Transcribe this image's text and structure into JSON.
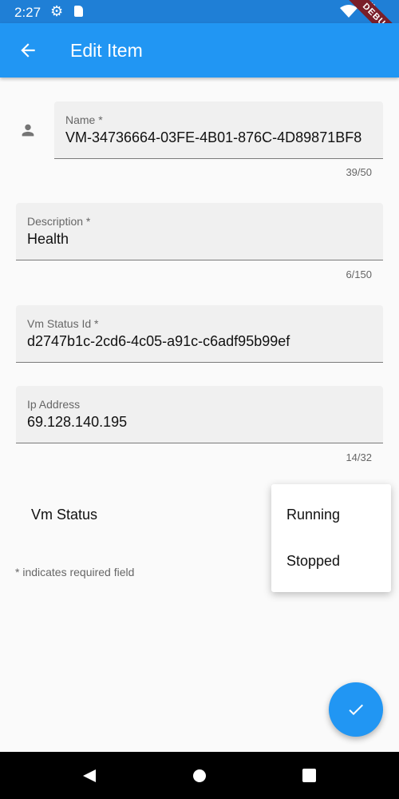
{
  "status_bar": {
    "time": "2:27",
    "debug_banner": "DEBUG"
  },
  "app_bar": {
    "title": "Edit Item"
  },
  "form": {
    "name": {
      "label": "Name *",
      "value": "VM-34736664-03FE-4B01-876C-4D89871BF8",
      "counter": "39/50"
    },
    "description": {
      "label": "Description *",
      "value": "Health",
      "counter": "6/150"
    },
    "vm_status_id": {
      "label": "Vm Status Id *",
      "value": "d2747b1c-2cd6-4c05-a91c-c6adf95b99ef"
    },
    "ip_address": {
      "label": "Ip Address",
      "value": "69.128.140.195",
      "counter": "14/32"
    },
    "vm_status_label": "Vm Status",
    "required_note": "* indicates required field"
  },
  "dropdown_menu": {
    "options": [
      "Running",
      "Stopped"
    ]
  },
  "colors": {
    "primary": "#2196f3",
    "status_bar": "#1f7fd6",
    "background": "#fafafa"
  },
  "icons": [
    "back-arrow-icon",
    "settings-gear-icon",
    "sd-card-icon",
    "wifi-icon",
    "battery-icon",
    "person-icon",
    "check-icon",
    "nav-back-icon",
    "nav-home-icon",
    "nav-recents-icon"
  ]
}
